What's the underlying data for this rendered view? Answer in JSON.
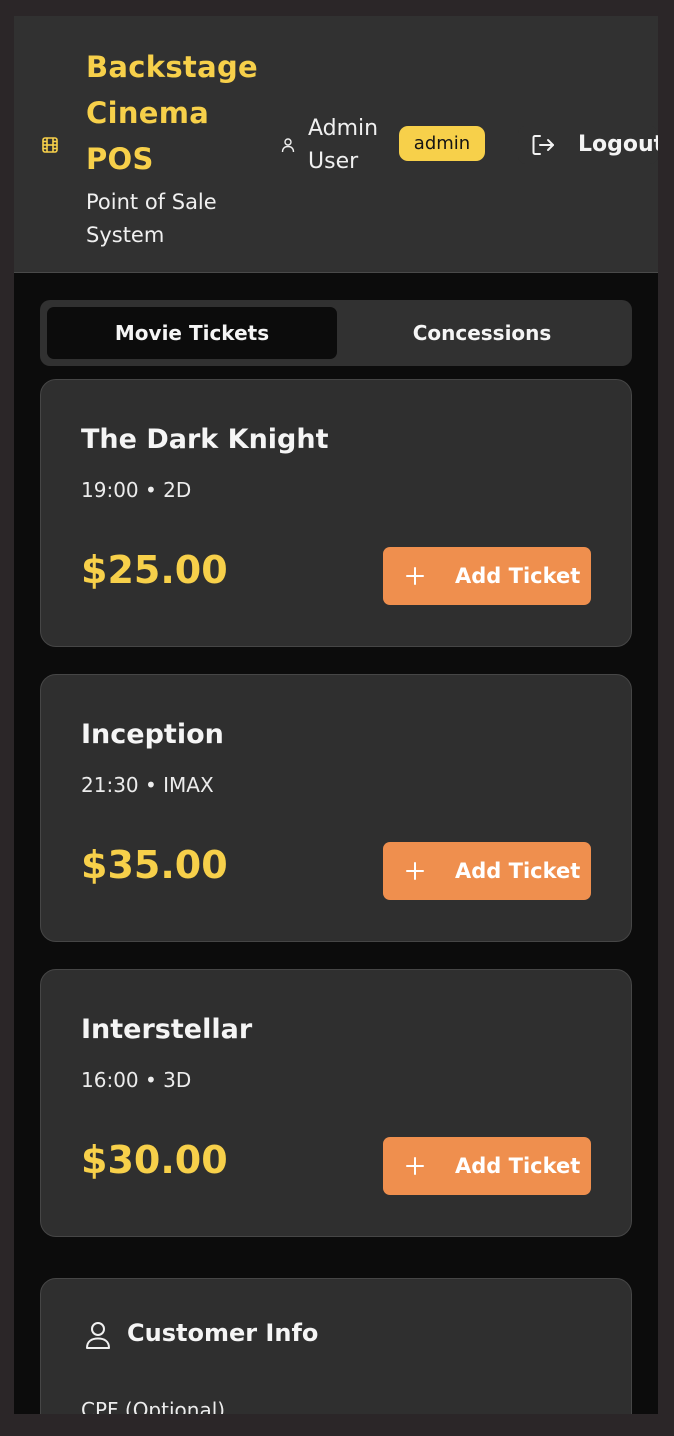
{
  "header": {
    "brand_title_lines": [
      "Backstage",
      "Cinema",
      "POS"
    ],
    "brand_subtitle_lines": [
      "Point of Sale",
      "System"
    ],
    "user_name_lines": [
      "Admin",
      "User"
    ],
    "role_badge": "admin",
    "logout_label": "Logout",
    "icons": {
      "brand": "film-icon",
      "user": "user-icon",
      "logout": "logout-icon"
    }
  },
  "tabs": [
    {
      "label": "Movie Tickets",
      "active": true
    },
    {
      "label": "Concessions",
      "active": false
    }
  ],
  "movies": [
    {
      "title": "The Dark Knight",
      "meta": "19:00 • 2D",
      "price": "$25.00",
      "button": "Add Ticket"
    },
    {
      "title": "Inception",
      "meta": "21:30 • IMAX",
      "price": "$35.00",
      "button": "Add Ticket"
    },
    {
      "title": "Interstellar",
      "meta": "16:00 • 3D",
      "price": "$30.00",
      "button": "Add Ticket"
    }
  ],
  "customer": {
    "title": "Customer Info",
    "cpf_label": "CPF (Optional)"
  },
  "colors": {
    "accent_yellow": "#f7d04a",
    "button_orange": "#ef8f4e",
    "card_bg": "#2f2f2f",
    "page_bg": "#0c0c0c"
  }
}
